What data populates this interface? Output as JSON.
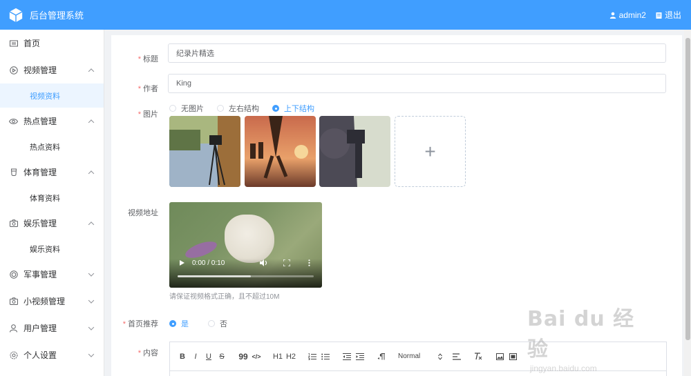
{
  "header": {
    "app_title": "后台管理系统",
    "user": "admin2",
    "logout": "退出"
  },
  "sidebar": {
    "items": [
      {
        "label": "首页",
        "icon": "grid-icon"
      },
      {
        "label": "视频管理",
        "icon": "play-circle-icon",
        "expanded": true,
        "sub": "视频资料"
      },
      {
        "label": "热点管理",
        "icon": "eye-icon",
        "expanded": true,
        "sub": "热点资料"
      },
      {
        "label": "体育管理",
        "icon": "cup-icon",
        "expanded": true,
        "sub": "体育资料"
      },
      {
        "label": "娱乐管理",
        "icon": "camera-icon",
        "expanded": true,
        "sub": "娱乐资料"
      },
      {
        "label": "军事管理",
        "icon": "target-icon",
        "expanded": false
      },
      {
        "label": "小视频管理",
        "icon": "camera-icon",
        "expanded": false
      },
      {
        "label": "用户管理",
        "icon": "user-icon",
        "expanded": false
      },
      {
        "label": "个人设置",
        "icon": "setting-icon",
        "expanded": false
      }
    ],
    "active_sub": "视频资料"
  },
  "form": {
    "title_label": "标题",
    "title_value": "纪录片精选",
    "author_label": "作者",
    "author_value": "King",
    "image_label": "图片",
    "image_options": [
      "无图片",
      "左右结构",
      "上下结构"
    ],
    "image_selected": "上下结构",
    "upload_plus": "+",
    "video_label": "视频地址",
    "video_time": "0:00 / 0:10",
    "video_progress": 0.0,
    "video_hint": "请保证视频格式正确，且不超过10M",
    "recommend_label": "首页推荐",
    "recommend_options": [
      "是",
      "否"
    ],
    "recommend_selected": "是",
    "content_label": "内容",
    "editor_toolbar": {
      "bold": "B",
      "italic": "I",
      "underline": "U",
      "strike": "S",
      "quote": "99",
      "code": "</>",
      "h1": "H1",
      "h2": "H2",
      "format_select": "Normal"
    }
  },
  "watermark": {
    "brand": "Bai du 经验",
    "url": "jingyan.baidu.com"
  },
  "colors": {
    "accent": "#409eff",
    "required": "#f56c6c",
    "active_menu_bg": "#ecf5ff"
  }
}
